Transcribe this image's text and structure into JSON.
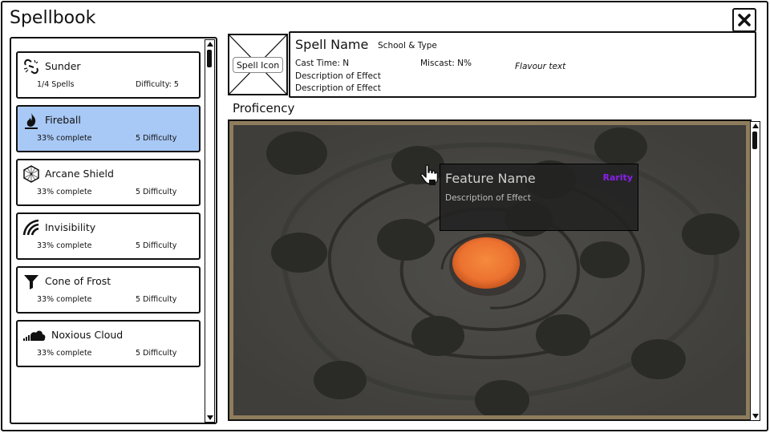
{
  "app": {
    "title": "Spellbook"
  },
  "spell_list": {
    "items": [
      {
        "name": "Sunder",
        "progress": "1/4 Spells",
        "difficulty": "Difficulty: 5",
        "icon": "broken-chain-icon",
        "selected": false
      },
      {
        "name": "Fireball",
        "progress": "33% complete",
        "difficulty": "5 Difficulty",
        "icon": "flame-icon",
        "selected": true
      },
      {
        "name": "Arcane Shield",
        "progress": "33% complete",
        "difficulty": "5 Difficulty",
        "icon": "hexagon-shield-icon",
        "selected": false
      },
      {
        "name": "Invisibility",
        "progress": "33% complete",
        "difficulty": "5 Difficulty",
        "icon": "wind-icon",
        "selected": false
      },
      {
        "name": "Cone of Frost",
        "progress": "33% complete",
        "difficulty": "5 Difficulty",
        "icon": "funnel-icon",
        "selected": false
      },
      {
        "name": "Noxious Cloud",
        "progress": "33% complete",
        "difficulty": "5 Difficulty",
        "icon": "cloud-icon",
        "selected": false
      }
    ]
  },
  "spell_detail": {
    "icon_placeholder": "Spell Icon",
    "name": "Spell Name",
    "school_type": "School & Type",
    "cast_time": "Cast Time: N",
    "miscast": "Miscast: N%",
    "flavour": "Flavour text",
    "descriptions": [
      "Description of Effect",
      "Description of Effect"
    ]
  },
  "proficiency": {
    "title": "Proficency",
    "tooltip": {
      "feature_name": "Feature Name",
      "rarity": "Rarity",
      "description": "Description of Effect"
    }
  },
  "colors": {
    "selected_card": "#a8c8f5",
    "map_background": "#4a4945",
    "frame": "#8e7c5c",
    "node": "#2a2a27",
    "core_glow": "#f07a30",
    "rarity": "#8a1ef0"
  }
}
